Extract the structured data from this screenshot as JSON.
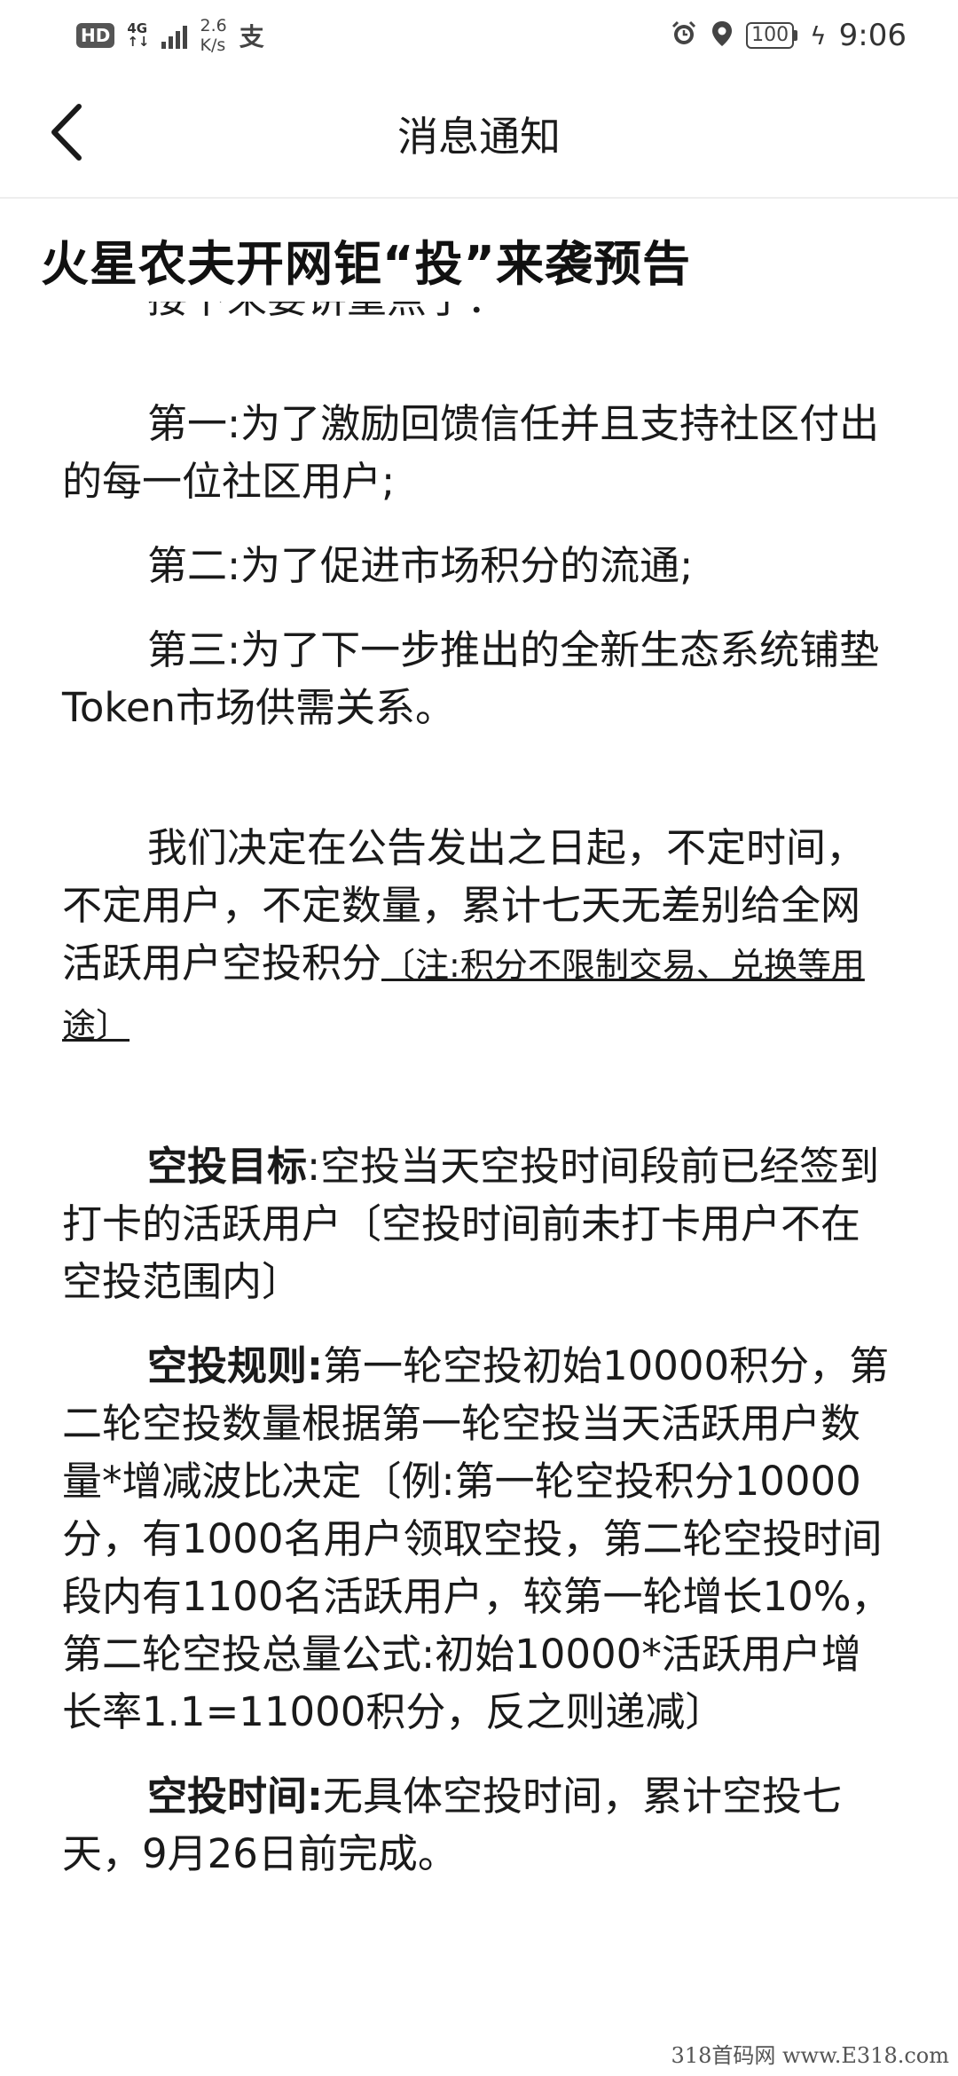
{
  "status_bar": {
    "hd": "HD",
    "net_type_top": "4G",
    "net_type_bottom": "↑↓",
    "speed_value": "2.6",
    "speed_unit": "K/s",
    "alipay_glyph": "支",
    "battery": "100",
    "time": "9:06"
  },
  "toolbar": {
    "title": "消息通知"
  },
  "article": {
    "title": "火星农夫开网钜“投”来袭预告",
    "cut_line": "接下来要讲重点了：",
    "p1": "第一:为了激励回馈信任并且支持社区付出的每一位社区用户;",
    "p2": "第二:为了促进市场积分的流通;",
    "p3": "第三:为了下一步推出的全新生态系统铺垫Token市场供需关系。",
    "p4_main": "我们决定在公告发出之日起，不定时间，不定用户，不定数量，累计七天无差别给全网活跃用户空投积分",
    "p4_note": "〔注:积分不限制交易、兑换等用途〕",
    "target_label": "空投目标",
    "target_text": ":空投当天空投时间段前已经签到打卡的活跃用户〔空投时间前未打卡用户不在空投范围内〕",
    "rule_label": "空投规则:",
    "rule_text": "第一轮空投初始10000积分，第二轮空投数量根据第一轮空投当天活跃用户数量*增减波比决定〔例:第一轮空投积分10000分，有1000名用户领取空投，第二轮空投时间段内有1100名活跃用户，较第一轮增长10%，第二轮空投总量公式:初始10000*活跃用户增长率1.1=11000积分，反之则递减〕",
    "time_label": "空投时间:",
    "time_text": "无具体空投时间，累计空投七天，9月26日前完成。"
  },
  "watermark": "318首码网 www.E318.com"
}
